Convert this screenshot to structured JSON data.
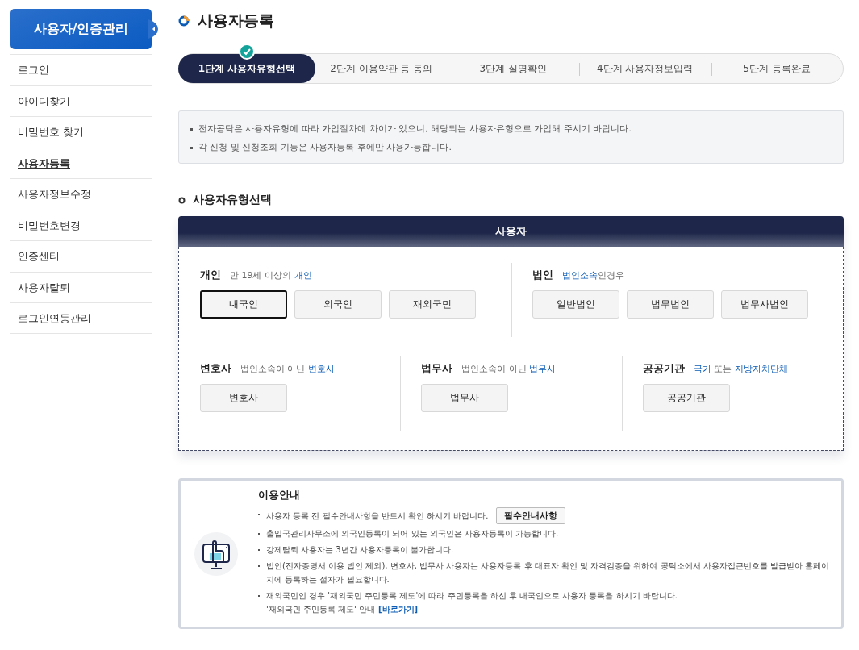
{
  "sidebar": {
    "title": "사용자/인증관리",
    "items": [
      {
        "label": "로그인",
        "selected": false
      },
      {
        "label": "아이디찾기",
        "selected": false
      },
      {
        "label": "비밀번호 찾기",
        "selected": false
      },
      {
        "label": "사용자등록",
        "selected": true
      },
      {
        "label": "사용자정보수정",
        "selected": false
      },
      {
        "label": "비밀번호변경",
        "selected": false
      },
      {
        "label": "인증센터",
        "selected": false
      },
      {
        "label": "사용자탈퇴",
        "selected": false
      },
      {
        "label": "로그인연동관리",
        "selected": false
      }
    ]
  },
  "page_title": "사용자등록",
  "steps": [
    {
      "label": "1단계 사용자유형선택",
      "selected": true
    },
    {
      "label": "2단계 이용약관 등 동의",
      "selected": false
    },
    {
      "label": "3단계 실명확인",
      "selected": false
    },
    {
      "label": "4단계 사용자정보입력",
      "selected": false
    },
    {
      "label": "5단계 등록완료",
      "selected": false
    }
  ],
  "notices": [
    "전자공탁은 사용자유형에 따라 가입절차에 차이가 있으니, 해당되는 사용자유형으로 가입해 주시기 바랍니다.",
    "각 신청 및 신청조회 기능은 사용자등록 후에만 사용가능합니다."
  ],
  "section_title": "사용자유형선택",
  "panel": {
    "header": "사용자",
    "rows": [
      [
        {
          "title": "개인",
          "desc": [
            {
              "text": "만 19세 이상의 ",
              "highlight": false
            },
            {
              "text": "개인",
              "highlight": true
            }
          ],
          "buttons": [
            {
              "label": "내국인",
              "selected": true
            },
            {
              "label": "외국인",
              "selected": false
            },
            {
              "label": "재외국민",
              "selected": false
            }
          ]
        },
        {
          "title": "법인",
          "desc": [
            {
              "text": "법인소속",
              "highlight": true
            },
            {
              "text": "인경우",
              "highlight": false
            }
          ],
          "buttons": [
            {
              "label": "일반법인",
              "selected": false
            },
            {
              "label": "법무법인",
              "selected": false
            },
            {
              "label": "법무사법인",
              "selected": false
            }
          ]
        }
      ],
      [
        {
          "title": "변호사",
          "desc": [
            {
              "text": "법인소속이 아닌 ",
              "highlight": false
            },
            {
              "text": "변호사",
              "highlight": true
            }
          ],
          "buttons": [
            {
              "label": "변호사",
              "selected": false
            }
          ]
        },
        {
          "title": "법무사",
          "desc": [
            {
              "text": "법인소속이 아닌 ",
              "highlight": false
            },
            {
              "text": "법무사",
              "highlight": true
            }
          ],
          "buttons": [
            {
              "label": "법무사",
              "selected": false
            }
          ]
        },
        {
          "title": "공공기관",
          "desc": [
            {
              "text": "국가",
              "highlight": true
            },
            {
              "text": " 또는 ",
              "highlight": false
            },
            {
              "text": "지방자치단체",
              "highlight": true
            }
          ],
          "buttons": [
            {
              "label": "공공기관",
              "selected": false
            }
          ]
        }
      ]
    ]
  },
  "guide": {
    "title": "이용안내",
    "items": [
      {
        "text": "사용자 등록 전 필수안내사항을 반드시 확인 하시기 바랍니다.",
        "button": "필수안내사항"
      },
      {
        "text": "출입국관리사무소에 외국인등록이 되어 있는 외국인은 사용자등록이 가능합니다."
      },
      {
        "text": "강제탈퇴 사용자는 3년간 사용자등록이 불가합니다."
      },
      {
        "text": "법인(전자증명서 이용 법인 제외), 변호사, 법무사 사용자는 사용자등록 후 대표자 확인 및 자격검증을 위하여 공탁소에서 사용자접근번호를 발급받아 홈페이지에 등록하는 절차가 필요합니다."
      },
      {
        "text": "재외국민인 경우 '재외국민 주민등록 제도'에 따라 주민등록을 하신 후 내국인으로 사용자 등록을 하시기 바랍니다.",
        "note": "'재외국민 주민등록 제도' 안내",
        "link": "[바로가기]"
      }
    ]
  }
}
